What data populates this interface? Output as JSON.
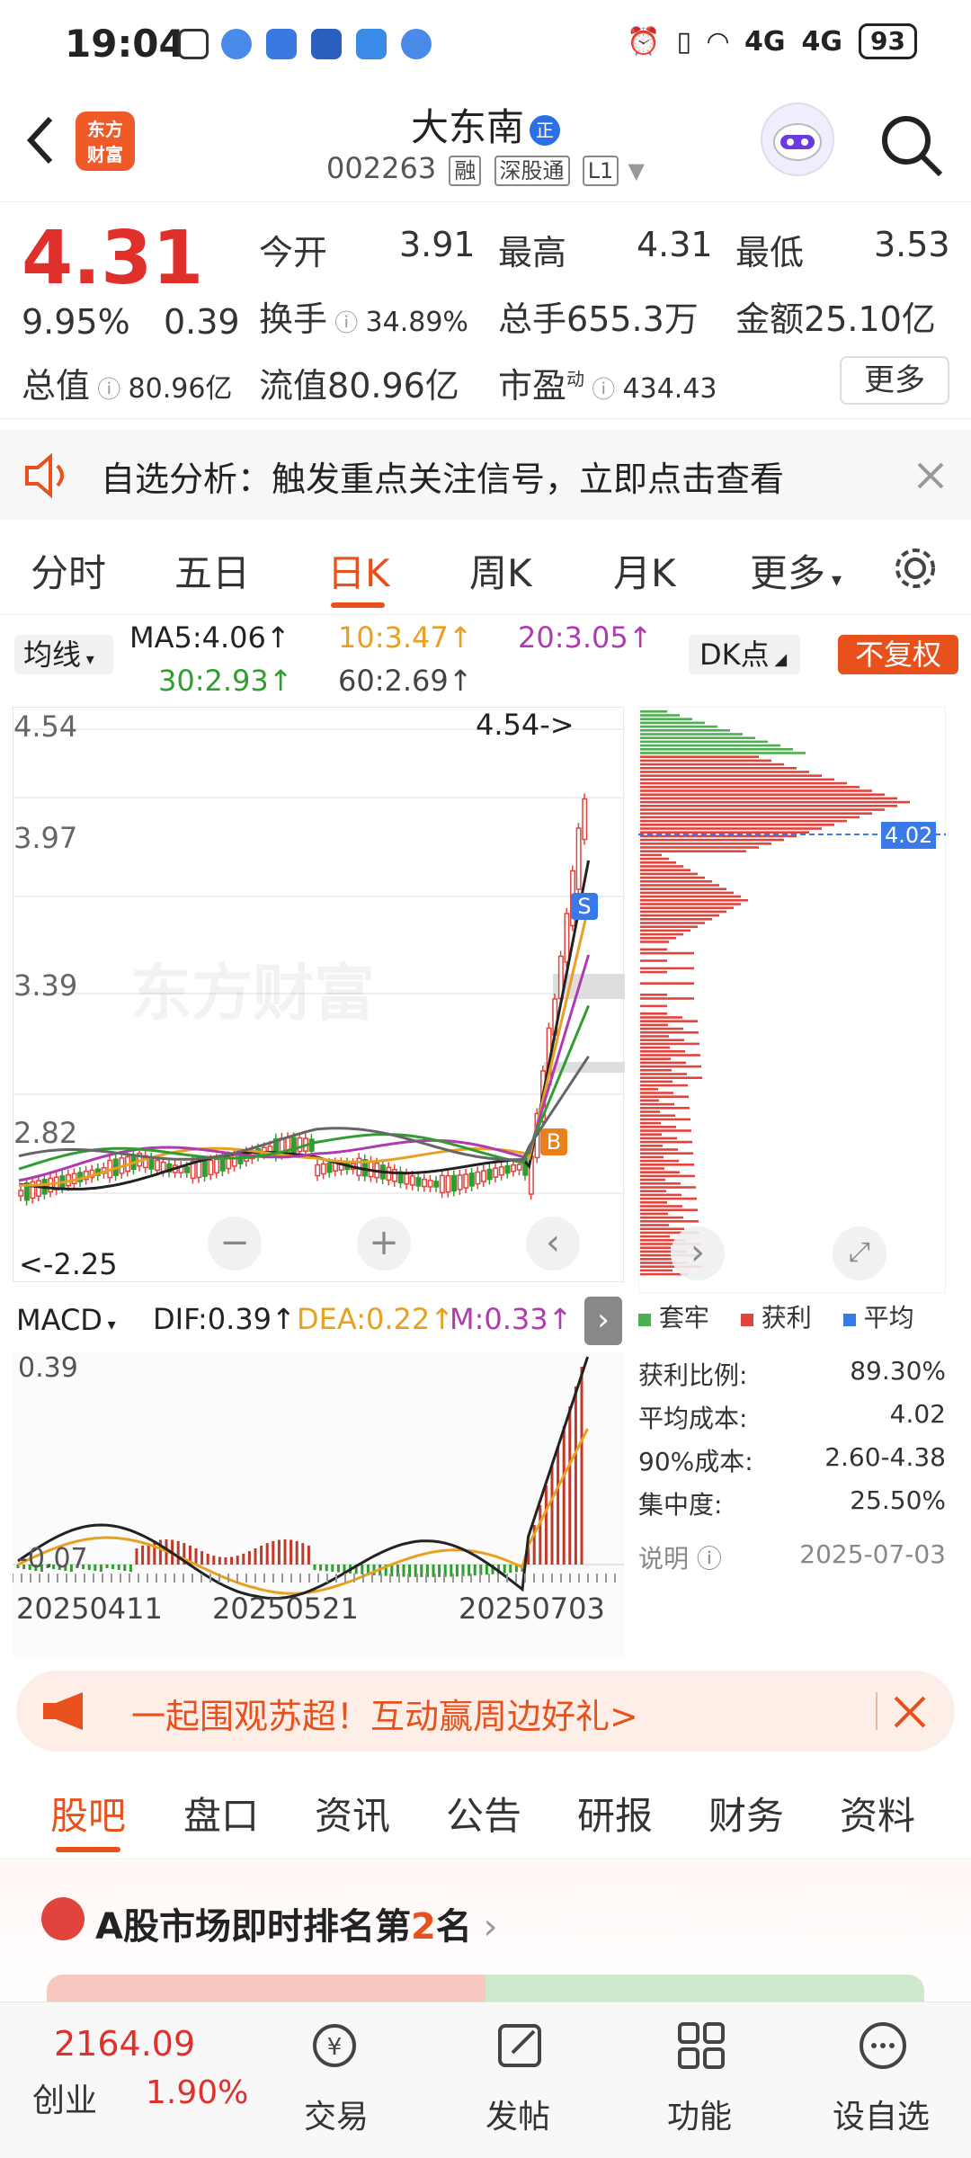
{
  "status_bar": {
    "time": "19:04",
    "battery": "93",
    "network": "4G"
  },
  "header": {
    "logo_text": "东方\n财富",
    "stock_name": "大东南",
    "name_badge": "正",
    "code": "002263",
    "tags": [
      "融",
      "深股通",
      "L1"
    ]
  },
  "quote": {
    "price": "4.31",
    "change_pct": "9.95%",
    "change": "0.39",
    "open_label": "今开",
    "open": "3.91",
    "high_label": "最高",
    "high": "4.31",
    "low_label": "最低",
    "low": "3.53",
    "turnover_label": "换手",
    "turnover": "34.89%",
    "volume_label": "总手",
    "volume": "655.3万",
    "amount_label": "金额",
    "amount": "25.10亿",
    "mcap_label": "总值",
    "mcap": "80.96亿",
    "float_label": "流值",
    "float": "80.96亿",
    "pe_label": "市盈",
    "pe_sup": "动",
    "pe": "434.43",
    "more": "更多"
  },
  "notice": {
    "text": "自选分析：触发重点关注信号，立即点击查看"
  },
  "period_tabs": [
    {
      "label": "分时"
    },
    {
      "label": "五日"
    },
    {
      "label": "日K"
    },
    {
      "label": "周K"
    },
    {
      "label": "月K"
    },
    {
      "label": "更多"
    }
  ],
  "ma": {
    "selector": "均线",
    "ma5": "MA5:4.06↑",
    "ma10": "10:3.47↑",
    "ma20": "20:3.05↑",
    "ma30": "30:2.93↑",
    "ma60": "60:2.69↑",
    "dk": "DK点",
    "adjust": "不复权"
  },
  "main_chart": {
    "y_labels": [
      "4.54",
      "3.97",
      "3.39",
      "2.82"
    ],
    "high_note": "4.54->",
    "low_note": "<-2.25",
    "watermark": "东方财富",
    "bar_marker_s": "S",
    "bar_marker_b": "B"
  },
  "chip": {
    "avg_label": "4.02",
    "legend": [
      "套牢",
      "获利",
      "平均"
    ],
    "legend_colors": [
      "#4caf50",
      "#e0443d",
      "#3a7ae8"
    ]
  },
  "macd": {
    "selector": "MACD",
    "dif": "DIF:0.39↑",
    "dea": "DEA:0.22↑",
    "m": "M:0.33↑",
    "y_top": "0.39",
    "y_bottom": "-0.07",
    "dates": [
      "20250411",
      "20250521",
      "20250703"
    ]
  },
  "chip_info": {
    "profit_ratio_label": "获利比例:",
    "profit_ratio": "89.30%",
    "avg_cost_label": "平均成本:",
    "avg_cost": "4.02",
    "cost90_label": "90%成本:",
    "cost90": "2.60-4.38",
    "concentration_label": "集中度:",
    "concentration": "25.50%",
    "note_label": "说明",
    "date": "2025-07-03"
  },
  "promo": {
    "text": "一起围观苏超！互动赢周边好礼>"
  },
  "bottom_tabs": [
    {
      "label": "股吧"
    },
    {
      "label": "盘口"
    },
    {
      "label": "资讯"
    },
    {
      "label": "公告"
    },
    {
      "label": "研报"
    },
    {
      "label": "财务"
    },
    {
      "label": "资料"
    }
  ],
  "rank": {
    "prefix": "A股市场即时排名第",
    "num": "2",
    "suffix": "名"
  },
  "footer": {
    "index_value": "2164.09",
    "index_name": "创业",
    "index_pct": "1.90%",
    "items": [
      "交易",
      "发帖",
      "功能",
      "设自选"
    ]
  }
}
